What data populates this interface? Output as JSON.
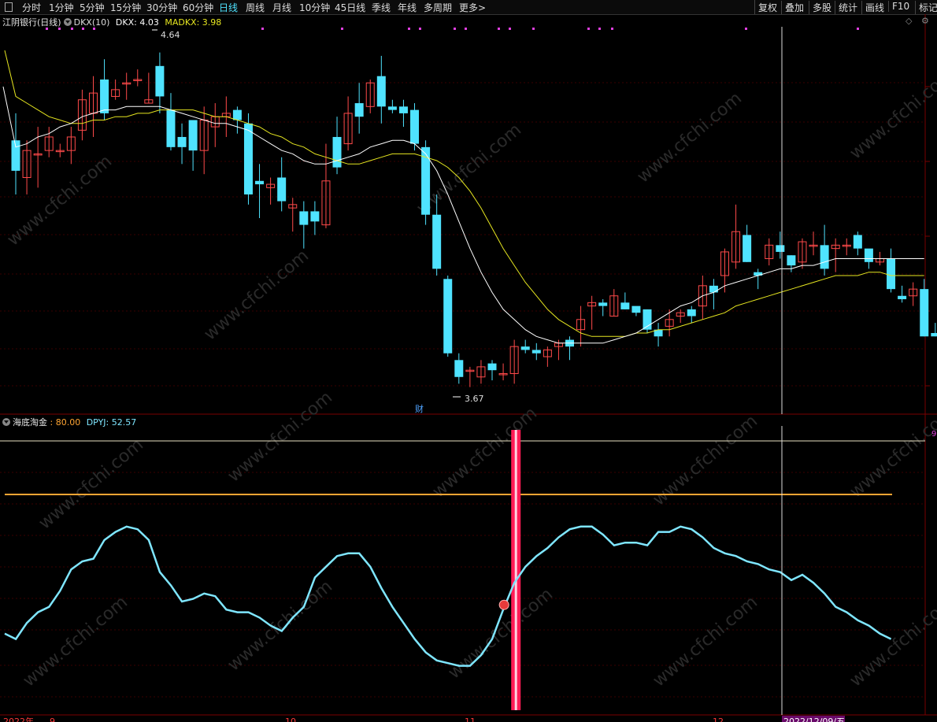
{
  "toolbar": {
    "periods": [
      {
        "label": "分时",
        "active": false
      },
      {
        "label": "1分钟",
        "active": false
      },
      {
        "label": "5分钟",
        "active": false
      },
      {
        "label": "15分钟",
        "active": false
      },
      {
        "label": "30分钟",
        "active": false
      },
      {
        "label": "60分钟",
        "active": false
      },
      {
        "label": "日线",
        "active": true
      },
      {
        "label": "周线",
        "active": false
      },
      {
        "label": "月线",
        "active": false
      },
      {
        "label": "10分钟",
        "active": false
      },
      {
        "label": "45日线",
        "active": false
      },
      {
        "label": "季线",
        "active": false
      },
      {
        "label": "年线",
        "active": false
      },
      {
        "label": "多周期",
        "active": false
      },
      {
        "label": "更多>",
        "active": false
      }
    ],
    "right_buttons": [
      "复权",
      "叠加",
      "多股",
      "统计",
      "画线",
      "F10",
      "标记"
    ]
  },
  "main_legend": {
    "stock": "江阴银行(日线)",
    "indicator": "DKX(10)",
    "dkx": "DKX: 4.03",
    "madkx": "MADKX: 3.98"
  },
  "price_marks": {
    "high": "4.64",
    "low": "3.67"
  },
  "event_marker": "财",
  "sub_legend": {
    "name": "海底淘金",
    "value1": ": 80.00",
    "dpyj": "DPYJ: 52.57"
  },
  "sub_axis_label": "9",
  "date_axis": {
    "labels": [
      "2022年",
      "9",
      "10",
      "11",
      "12"
    ],
    "cursor_date": "2022/12/09/五"
  },
  "colors": {
    "up": "#ff4a4a",
    "down": "#4fe3ff",
    "dkx": "#ffffff",
    "madkx": "#e6e620",
    "oscillator": "#7fe6ff",
    "level": "#ffa533",
    "signal": "#ff1a55",
    "grid": "#3a0000"
  },
  "chart_data": {
    "type": "candlestick",
    "candles": [
      [
        4.38,
        4.29,
        4.46,
        4.22
      ],
      [
        4.27,
        4.35,
        4.38,
        4.22
      ],
      [
        4.34,
        4.34,
        4.42,
        4.24
      ],
      [
        4.35,
        4.39,
        4.42,
        4.33
      ],
      [
        4.35,
        4.35,
        4.37,
        4.33
      ],
      [
        4.35,
        4.39,
        4.42,
        4.31
      ],
      [
        4.41,
        4.5,
        4.53,
        4.38
      ],
      [
        4.46,
        4.52,
        4.57,
        4.39
      ],
      [
        4.56,
        4.46,
        4.62,
        4.44
      ],
      [
        4.51,
        4.53,
        4.56,
        4.5
      ],
      [
        4.55,
        4.55,
        4.58,
        4.5
      ],
      [
        4.56,
        4.56,
        4.59,
        4.54
      ],
      [
        4.49,
        4.5,
        4.58,
        4.49
      ],
      [
        4.6,
        4.51,
        4.64,
        4.46
      ],
      [
        4.47,
        4.36,
        4.52,
        4.35
      ],
      [
        4.39,
        4.36,
        4.43,
        4.31
      ],
      [
        4.44,
        4.35,
        4.44,
        4.29
      ],
      [
        4.35,
        4.44,
        4.48,
        4.28
      ],
      [
        4.42,
        4.45,
        4.49,
        4.36
      ],
      [
        4.45,
        4.46,
        4.51,
        4.39
      ],
      [
        4.47,
        4.44,
        4.48,
        4.4
      ],
      [
        4.43,
        4.22,
        4.46,
        4.19
      ],
      [
        4.26,
        4.25,
        4.31,
        4.15
      ],
      [
        4.24,
        4.25,
        4.27,
        4.19
      ],
      [
        4.27,
        4.2,
        4.33,
        4.17
      ],
      [
        4.18,
        4.19,
        4.21,
        4.11
      ],
      [
        4.17,
        4.13,
        4.2,
        4.06
      ],
      [
        4.17,
        4.14,
        4.2,
        4.1
      ],
      [
        4.13,
        4.26,
        4.37,
        4.12
      ],
      [
        4.39,
        4.3,
        4.45,
        4.28
      ],
      [
        4.37,
        4.46,
        4.51,
        4.35
      ],
      [
        4.49,
        4.45,
        4.55,
        4.4
      ],
      [
        4.48,
        4.55,
        4.56,
        4.46
      ],
      [
        4.57,
        4.48,
        4.63,
        4.43
      ],
      [
        4.48,
        4.47,
        4.5,
        4.46
      ],
      [
        4.48,
        4.46,
        4.5,
        4.42
      ],
      [
        4.47,
        4.37,
        4.49,
        4.35
      ],
      [
        4.36,
        4.16,
        4.38,
        4.13
      ],
      [
        4.16,
        4.0,
        4.22,
        3.98
      ],
      [
        3.97,
        3.75,
        3.98,
        3.74
      ],
      [
        3.73,
        3.68,
        3.75,
        3.66
      ],
      [
        3.7,
        3.7,
        3.71,
        3.65
      ],
      [
        3.68,
        3.71,
        3.73,
        3.66
      ],
      [
        3.72,
        3.7,
        3.73,
        3.67
      ],
      [
        3.69,
        3.69,
        3.72,
        3.67
      ],
      [
        3.69,
        3.77,
        3.79,
        3.66
      ],
      [
        3.77,
        3.76,
        3.79,
        3.75
      ],
      [
        3.76,
        3.75,
        3.78,
        3.73
      ],
      [
        3.74,
        3.76,
        3.77,
        3.71
      ],
      [
        3.77,
        3.78,
        3.79,
        3.73
      ],
      [
        3.79,
        3.77,
        3.8,
        3.73
      ],
      [
        3.82,
        3.85,
        3.89,
        3.77
      ],
      [
        3.89,
        3.9,
        3.92,
        3.82
      ],
      [
        3.9,
        3.89,
        3.91,
        3.86
      ],
      [
        3.86,
        3.92,
        3.94,
        3.86
      ],
      [
        3.9,
        3.88,
        3.93,
        3.88
      ],
      [
        3.89,
        3.87,
        3.88,
        3.86
      ],
      [
        3.88,
        3.82,
        3.88,
        3.81
      ],
      [
        3.82,
        3.8,
        3.84,
        3.77
      ],
      [
        3.83,
        3.85,
        3.88,
        3.8
      ],
      [
        3.86,
        3.87,
        3.88,
        3.84
      ],
      [
        3.88,
        3.86,
        3.89,
        3.84
      ],
      [
        3.89,
        3.95,
        3.98,
        3.85
      ],
      [
        3.95,
        3.93,
        3.97,
        3.88
      ],
      [
        3.98,
        4.05,
        4.06,
        3.93
      ],
      [
        4.02,
        4.11,
        4.19,
        4.0
      ],
      [
        4.1,
        4.02,
        4.13,
        4.02
      ],
      [
        3.99,
        3.98,
        4.0,
        3.94
      ],
      [
        4.03,
        4.07,
        4.09,
        4.01
      ],
      [
        4.07,
        4.05,
        4.11,
        4.03
      ],
      [
        4.04,
        4.01,
        4.04,
        3.99
      ],
      [
        4.02,
        4.08,
        4.09,
        4.0
      ],
      [
        4.07,
        4.07,
        4.11,
        4.04
      ],
      [
        4.07,
        4.0,
        4.13,
        3.98
      ],
      [
        4.06,
        4.07,
        4.09,
        3.99
      ],
      [
        4.07,
        4.07,
        4.09,
        4.04
      ],
      [
        4.1,
        4.06,
        4.11,
        4.04
      ],
      [
        4.06,
        4.02,
        4.05,
        4.0
      ],
      [
        4.02,
        4.03,
        4.05,
        4.01
      ],
      [
        4.03,
        3.94,
        4.06,
        3.93
      ],
      [
        3.92,
        3.91,
        3.95,
        3.9
      ],
      [
        3.92,
        3.94,
        3.96,
        3.89
      ],
      [
        3.94,
        3.8,
        3.97,
        3.8
      ],
      [
        3.81,
        3.8,
        3.84,
        3.8
      ]
    ],
    "dkx": [
      4.36,
      4.37,
      4.39,
      4.4,
      4.42,
      4.43,
      4.45,
      4.46,
      4.47,
      4.47,
      4.48,
      4.48,
      4.48,
      4.48,
      4.47,
      4.46,
      4.45,
      4.44,
      4.43,
      4.43,
      4.42,
      4.41,
      4.39,
      4.37,
      4.35,
      4.34,
      4.32,
      4.31,
      4.31,
      4.32,
      4.33,
      4.34,
      4.36,
      4.37,
      4.38,
      4.38,
      4.37,
      4.34,
      4.29,
      4.22,
      4.14,
      4.06,
      3.99,
      3.93,
      3.88,
      3.85,
      3.82,
      3.8,
      3.79,
      3.78,
      3.78,
      3.78,
      3.78,
      3.78,
      3.79,
      3.8,
      3.81,
      3.83,
      3.85,
      3.87,
      3.89,
      3.9,
      3.92,
      3.93,
      3.95,
      3.96,
      3.97,
      3.98,
      3.99,
      4.0,
      4.0,
      4.01,
      4.01,
      4.02,
      4.03,
      4.03,
      4.03,
      4.03,
      4.03,
      4.03,
      4.03,
      4.03,
      4.03
    ],
    "madkx": [
      4.51,
      4.49,
      4.47,
      4.45,
      4.44,
      4.43,
      4.43,
      4.44,
      4.44,
      4.45,
      4.45,
      4.46,
      4.46,
      4.47,
      4.47,
      4.47,
      4.47,
      4.46,
      4.45,
      4.45,
      4.44,
      4.43,
      4.42,
      4.4,
      4.39,
      4.37,
      4.36,
      4.34,
      4.33,
      4.32,
      4.31,
      4.31,
      4.32,
      4.33,
      4.34,
      4.34,
      4.34,
      4.33,
      4.32,
      4.3,
      4.27,
      4.23,
      4.18,
      4.12,
      4.06,
      4.01,
      3.96,
      3.92,
      3.88,
      3.85,
      3.83,
      3.81,
      3.8,
      3.8,
      3.8,
      3.8,
      3.81,
      3.81,
      3.82,
      3.82,
      3.83,
      3.84,
      3.85,
      3.86,
      3.87,
      3.89,
      3.9,
      3.91,
      3.92,
      3.93,
      3.94,
      3.95,
      3.96,
      3.97,
      3.98,
      3.98,
      3.98,
      3.99,
      3.99,
      3.98,
      3.98,
      3.98,
      3.98
    ],
    "sub_indicator": {
      "level": 80,
      "signal_bar_index": 46,
      "signal_point_index": 45,
      "dpyj": [
        28,
        26,
        32,
        36,
        38,
        44,
        52,
        55,
        56,
        63,
        66,
        68,
        67,
        63,
        51,
        46,
        40,
        41,
        43,
        42,
        37,
        36,
        36,
        34,
        31,
        29,
        34,
        38,
        49,
        53,
        57,
        58,
        58,
        53,
        45,
        38,
        32,
        26,
        21,
        18,
        17,
        16,
        16,
        20,
        26,
        37,
        47,
        53,
        57,
        60,
        64,
        67,
        68,
        68,
        65,
        61,
        62,
        62,
        61,
        66,
        66,
        68,
        67,
        64,
        60,
        58,
        57,
        55,
        54,
        52,
        51,
        48,
        50,
        47,
        43,
        38,
        36,
        33,
        31,
        28,
        26
      ]
    }
  }
}
